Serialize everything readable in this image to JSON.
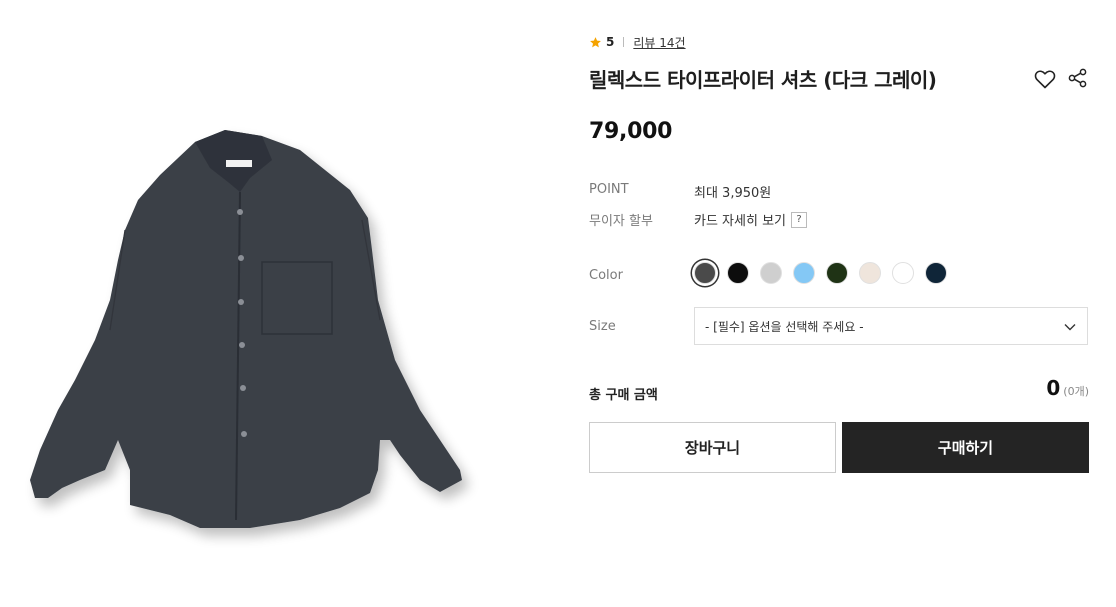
{
  "product": {
    "rating": "5",
    "review_link": "리뷰 14건",
    "title": "릴렉스드 타이프라이터 셔츠 (다크 그레이)",
    "price": "79,000",
    "image_icon": "dark-gray-shirt-photo"
  },
  "meta": {
    "point_label": "POINT",
    "point_value": "최대 3,950원",
    "installment_label": "무이자 할부",
    "installment_value": "카드 자세히 보기",
    "help_glyph": "?"
  },
  "options": {
    "color_label": "Color",
    "colors": [
      {
        "name": "dark-gray",
        "hex": "#4a4a4a",
        "selected": true
      },
      {
        "name": "black",
        "hex": "#0d0d0d",
        "selected": false
      },
      {
        "name": "light-gray",
        "hex": "#cfcfcf",
        "selected": false
      },
      {
        "name": "sky-blue",
        "hex": "#84c8f5",
        "selected": false
      },
      {
        "name": "dark-green",
        "hex": "#1f3315",
        "selected": false
      },
      {
        "name": "beige",
        "hex": "#efe5dc",
        "selected": false
      },
      {
        "name": "white",
        "hex": "#ffffff",
        "selected": false
      },
      {
        "name": "navy",
        "hex": "#0f2538",
        "selected": false
      }
    ],
    "size_label": "Size",
    "size_placeholder": "- [필수] 옵션을 선택해 주세요 -"
  },
  "total": {
    "label": "총 구매 금액",
    "value": "0",
    "count": "(0개)"
  },
  "buttons": {
    "cart": "장바구니",
    "buy": "구매하기"
  },
  "icons": {
    "star": "star-icon",
    "heart": "heart-icon",
    "share": "share-icon",
    "chevron": "chevron-down-icon"
  },
  "colors": {
    "star": "#f5a300",
    "buy_button": "#242424",
    "text": "#222222"
  }
}
